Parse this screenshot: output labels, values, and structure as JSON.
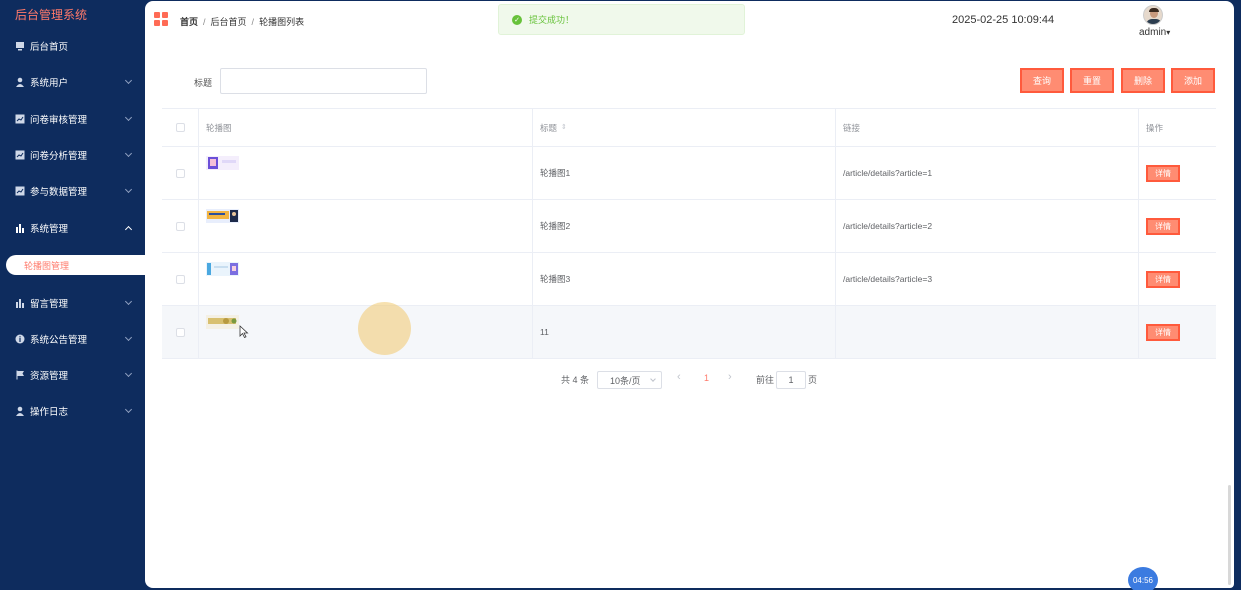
{
  "brand": "后台管理系统",
  "sidebar": {
    "items": [
      {
        "label": "后台首页",
        "icon": "monitor-icon",
        "has_children": false
      },
      {
        "label": "系统用户",
        "icon": "user-icon",
        "has_children": true
      },
      {
        "label": "问卷审核管理",
        "icon": "chart-box-icon",
        "has_children": true
      },
      {
        "label": "问卷分析管理",
        "icon": "chart-box-icon",
        "has_children": true
      },
      {
        "label": "参与数据管理",
        "icon": "chart-box-icon",
        "has_children": true
      },
      {
        "label": "系统管理",
        "icon": "bar-chart-icon",
        "has_children": true,
        "expanded": true
      },
      {
        "label": "留言管理",
        "icon": "bar-chart-icon",
        "has_children": true
      },
      {
        "label": "系统公告管理",
        "icon": "info-icon",
        "has_children": true
      },
      {
        "label": "资源管理",
        "icon": "flag-icon",
        "has_children": true
      },
      {
        "label": "操作日志",
        "icon": "user-icon",
        "has_children": true
      }
    ],
    "active_sub_item": "轮播图管理"
  },
  "header": {
    "breadcrumb": [
      "首页",
      "后台首页",
      "轮播图列表"
    ],
    "separator": "/",
    "datetime": "2025-02-25 10:09:44",
    "username": "admin",
    "dropdown_caret": "▾"
  },
  "toast": {
    "message": "提交成功！",
    "type": "success",
    "check": "✓"
  },
  "search": {
    "label": "标题",
    "value": "",
    "placeholder": ""
  },
  "buttons": {
    "query": "查询",
    "reset": "重置",
    "delete": "删除",
    "add": "添加"
  },
  "table": {
    "headers": {
      "image": "轮播图",
      "title": "标题",
      "link": "链接",
      "actions": "操作"
    },
    "sort_icon": "⇕",
    "rows": [
      {
        "title": "轮播图1",
        "link": "/article/details?article=1",
        "action": "详情"
      },
      {
        "title": "轮播图2",
        "link": "/article/details?article=2",
        "action": "详情"
      },
      {
        "title": "轮播图3",
        "link": "/article/details?article=3",
        "action": "详情"
      },
      {
        "title": "11",
        "link": "",
        "action": "详情"
      }
    ]
  },
  "pagination": {
    "total": "共 4 条",
    "page_size": "10条/页",
    "prev": "‹",
    "current": "1",
    "next": "›",
    "goto_label": "前往",
    "goto_value": "1",
    "page_unit": "页"
  },
  "timer": "04:56",
  "colors": {
    "sidebar_bg": "#0e2c5e",
    "accent": "#ff7a6b",
    "button": "#ff8c72",
    "success": "#67c23a"
  }
}
